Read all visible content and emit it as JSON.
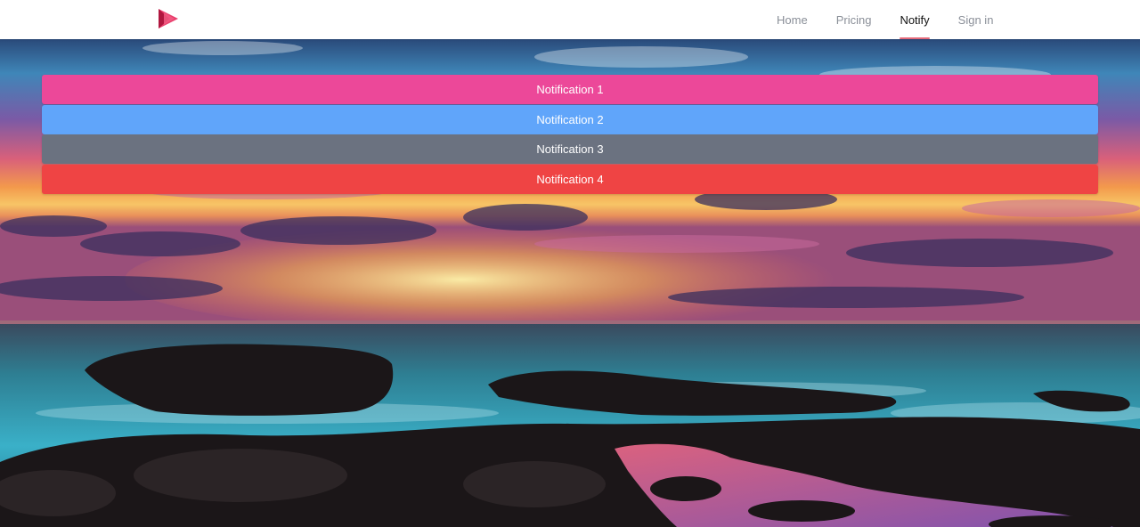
{
  "navbar": {
    "logo_icon": "play-triangle-logo-icon",
    "links": [
      {
        "label": "Home",
        "active": false
      },
      {
        "label": "Pricing",
        "active": false
      },
      {
        "label": "Notify",
        "active": true
      },
      {
        "label": "Sign in",
        "active": false
      }
    ]
  },
  "notifications": [
    {
      "label": "Notification 1",
      "color": "#ec4899"
    },
    {
      "label": "Notification 2",
      "color": "#60a5fa"
    },
    {
      "label": "Notification 3",
      "color": "#6b7280"
    },
    {
      "label": "Notification 4",
      "color": "#ef4444"
    }
  ],
  "colors": {
    "active_underline": "#e56a7a",
    "logo_dark": "#b0173f",
    "logo_light": "#e83e6c"
  }
}
